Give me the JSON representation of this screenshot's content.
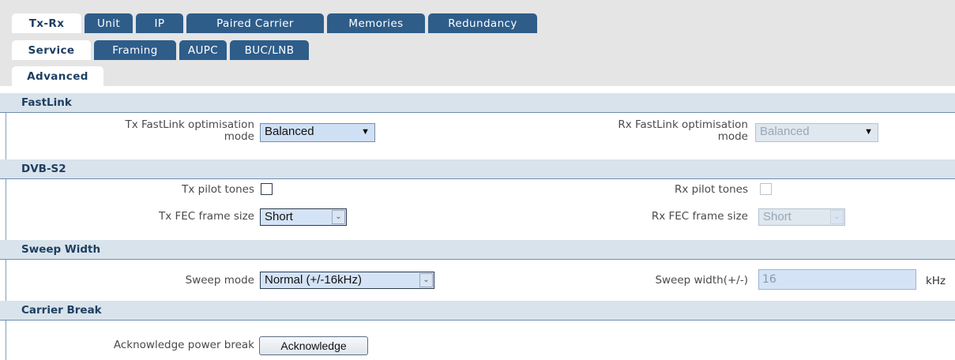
{
  "tabs_row1": [
    {
      "label": "Tx-Rx",
      "active": true
    },
    {
      "label": "Unit"
    },
    {
      "label": "IP"
    },
    {
      "label": "Paired Carrier"
    },
    {
      "label": "Memories"
    },
    {
      "label": "Redundancy"
    }
  ],
  "tabs_row2": [
    {
      "label": "Service",
      "active": true
    },
    {
      "label": "Framing"
    },
    {
      "label": "AUPC"
    },
    {
      "label": "BUC/LNB"
    }
  ],
  "tabs_row3": [
    {
      "label": "Advanced",
      "active": true
    }
  ],
  "sections": {
    "fastlink": "FastLink",
    "dvbs2": "DVB-S2",
    "sweep": "Sweep Width",
    "carrier": "Carrier Break"
  },
  "fastlink": {
    "tx_label_line1": "Tx FastLink optimisation",
    "tx_label_line2": "mode",
    "tx_value": "Balanced",
    "rx_label_line1": "Rx FastLink optimisation",
    "rx_label_line2": "mode",
    "rx_value": "Balanced"
  },
  "dvbs2": {
    "tx_pilot_label": "Tx pilot tones",
    "rx_pilot_label": "Rx pilot tones",
    "tx_fec_label": "Tx FEC frame size",
    "tx_fec_value": "Short",
    "rx_fec_label": "Rx FEC frame size",
    "rx_fec_value": "Short"
  },
  "sweep": {
    "mode_label": "Sweep mode",
    "mode_value": "Normal (+/-16kHz)",
    "width_label": "Sweep width(+/-)",
    "width_value": "16",
    "width_unit": "kHz"
  },
  "carrier": {
    "ack_label": "Acknowledge power break",
    "ack_button": "Acknowledge"
  },
  "colors": {
    "tab_bg": "#2e5d8a",
    "section_bg": "#d9e3ec",
    "field_bg": "#d4e3f6"
  },
  "icons": {
    "dropdown": "▼",
    "dropdown_small": "⌄"
  }
}
